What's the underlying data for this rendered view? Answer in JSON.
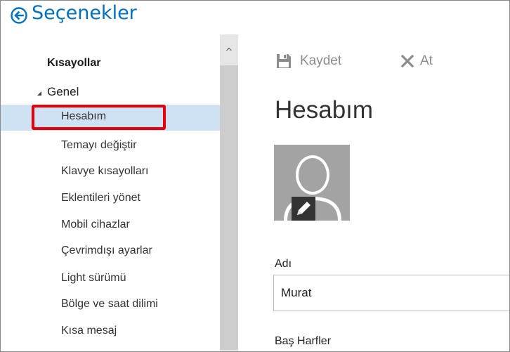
{
  "header": {
    "title": "Seçenekler",
    "back_icon": "back-arrow-circle-icon",
    "accent_color": "#0072c6"
  },
  "sidebar": {
    "section_title": "Kısayollar",
    "group_label": "Genel",
    "items": [
      {
        "label": "Hesabım",
        "selected": true
      },
      {
        "label": "Temayı değiştir"
      },
      {
        "label": "Klavye kısayolları"
      },
      {
        "label": "Eklentileri yönet"
      },
      {
        "label": "Mobil cihazlar"
      },
      {
        "label": "Çevrimdışı ayarlar"
      },
      {
        "label": "Light sürümü"
      },
      {
        "label": "Bölge ve saat dilimi"
      },
      {
        "label": "Kısa mesaj"
      }
    ],
    "highlight_color": "#e8000a",
    "selected_bg": "#cfe2f3"
  },
  "scrollbar": {
    "up_glyph": "^"
  },
  "toolbar": {
    "save_label": "Kaydet",
    "save_icon": "floppy-disk-icon",
    "discard_label": "At",
    "discard_icon": "x-icon"
  },
  "main": {
    "heading": "Hesabım",
    "avatar_icon": "person-silhouette-icon",
    "edit_icon": "pencil-icon",
    "first_name_label": "Adı",
    "first_name_value": "Murat",
    "initials_label": "Baş Harfler"
  }
}
